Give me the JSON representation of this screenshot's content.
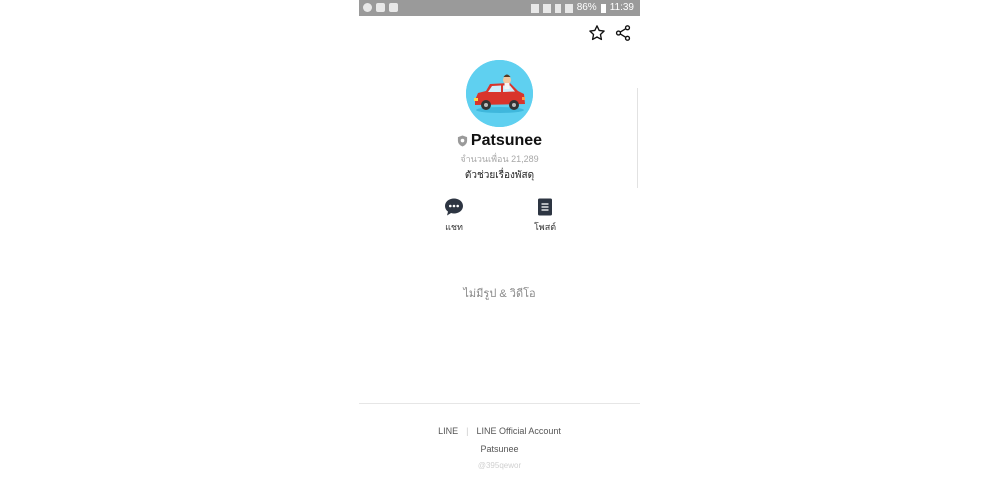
{
  "status_bar": {
    "battery": "86%",
    "time": "11:39"
  },
  "profile": {
    "name": "Patsunee",
    "friends_count": "จำนวนเพื่อน 21,289",
    "status_message": "ตัวช่วยเรื่องพัสดุ"
  },
  "actions": [
    {
      "label": "แชท",
      "icon": "chat-bubble-icon"
    },
    {
      "label": "โพสต์",
      "icon": "post-document-icon"
    }
  ],
  "media": {
    "empty_text": "ไม่มีรูป & วิดีโอ"
  },
  "footer": {
    "link_line": "LINE",
    "link_official": "LINE Official Account",
    "account_name": "Patsunee",
    "account_id": "@395qewor"
  },
  "colors": {
    "status_bar": "#9a9a9a",
    "avatar_bg": "#5fd0f0",
    "car_red": "#d9342b"
  }
}
